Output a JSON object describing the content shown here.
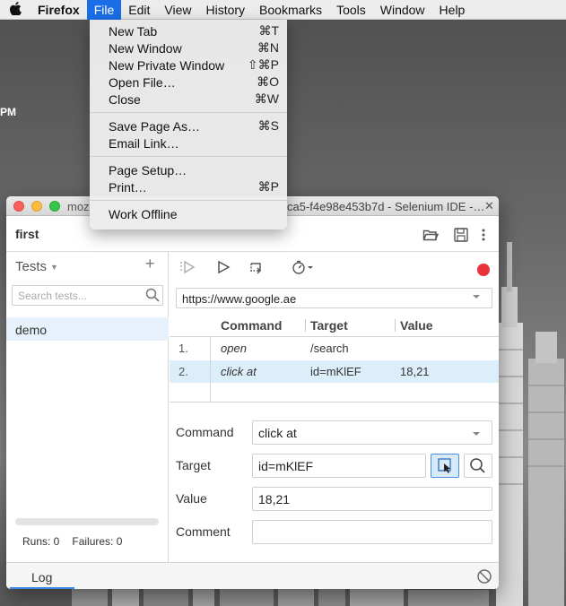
{
  "menubar": {
    "app_name": "Firefox",
    "items": [
      "File",
      "Edit",
      "View",
      "History",
      "Bookmarks",
      "Tools",
      "Window",
      "Help"
    ],
    "active_item": "File"
  },
  "desktop": {
    "clock_fragment": "PM"
  },
  "file_menu": {
    "groups": [
      [
        {
          "label": "New Tab",
          "shortcut": "⌘T"
        },
        {
          "label": "New Window",
          "shortcut": "⌘N"
        },
        {
          "label": "New Private Window",
          "shortcut": "⇧⌘P"
        },
        {
          "label": "Open File…",
          "shortcut": "⌘O"
        },
        {
          "label": "Close",
          "shortcut": "⌘W"
        }
      ],
      [
        {
          "label": "Save Page As…",
          "shortcut": "⌘S"
        },
        {
          "label": "Email Link…",
          "shortcut": ""
        }
      ],
      [
        {
          "label": "Page Setup…",
          "shortcut": ""
        },
        {
          "label": "Print…",
          "shortcut": "⌘P"
        }
      ],
      [
        {
          "label": "Work Offline",
          "shortcut": ""
        }
      ]
    ]
  },
  "window": {
    "title_visible": "moz",
    "title_tail": "ca5-f4e98e453b7d - Selenium IDE -…",
    "close_glyph": "✕"
  },
  "project": {
    "name": "first"
  },
  "sidebar": {
    "header": "Tests",
    "add_glyph": "+",
    "search_placeholder": "Search tests...",
    "tests": [
      "demo"
    ],
    "selected_test": "demo",
    "runs_label": "Runs: 0",
    "failures_label": "Failures: 0",
    "progress": 0
  },
  "url_bar": {
    "value": "https://www.google.ae"
  },
  "table": {
    "headers": {
      "command": "Command",
      "target": "Target",
      "value": "Value"
    },
    "rows": [
      {
        "num": "1.",
        "command": "open",
        "target": "/search",
        "value": "",
        "selected": false
      },
      {
        "num": "2.",
        "command": "click at",
        "target": "id=mKlEF",
        "value": "18,21",
        "selected": true
      }
    ]
  },
  "editor": {
    "command_label": "Command",
    "command_value": "click at",
    "target_label": "Target",
    "target_value": "id=mKlEF",
    "value_label": "Value",
    "value_value": "18,21",
    "comment_label": "Comment",
    "comment_value": ""
  },
  "log": {
    "tab_label": "Log"
  },
  "colors": {
    "accent": "#1b6ee8",
    "record": "#e8333a",
    "selection": "#ddeefb"
  }
}
